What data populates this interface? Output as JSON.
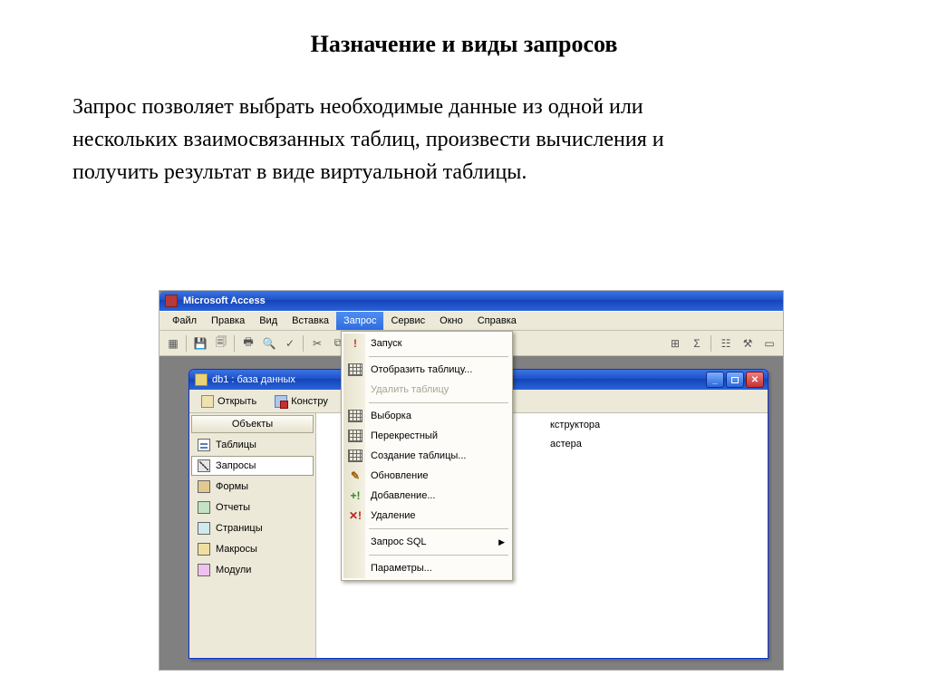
{
  "slide": {
    "title": "Назначение и виды запросов",
    "paragraph": "Запрос позволяет выбрать необходимые данные из одной или нескольких взаимосвязанных таблиц, произвести вычисления и получить результат в виде виртуальной таблицы."
  },
  "app": {
    "title": "Microsoft Access"
  },
  "menubar": [
    "Файл",
    "Правка",
    "Вид",
    "Вставка",
    "Запрос",
    "Сервис",
    "Окно",
    "Справка"
  ],
  "menubar_active_index": 4,
  "dropdown": {
    "items": [
      {
        "label": "Запуск",
        "icon": "run",
        "disabled": false
      },
      {
        "sep": true
      },
      {
        "label": "Отобразить таблицу...",
        "icon": "grid",
        "disabled": false
      },
      {
        "label": "Удалить таблицу",
        "icon": "",
        "disabled": true
      },
      {
        "sep": true
      },
      {
        "label": "Выборка",
        "icon": "grid",
        "disabled": false
      },
      {
        "label": "Перекрестный",
        "icon": "grid",
        "disabled": false
      },
      {
        "label": "Создание таблицы...",
        "icon": "grid",
        "disabled": false
      },
      {
        "label": "Обновление",
        "icon": "update",
        "disabled": false
      },
      {
        "label": "Добавление...",
        "icon": "add",
        "disabled": false
      },
      {
        "label": "Удаление",
        "icon": "del",
        "disabled": false
      },
      {
        "sep": true
      },
      {
        "label": "Запрос SQL",
        "icon": "",
        "submenu": true
      },
      {
        "sep": true
      },
      {
        "label": "Параметры...",
        "icon": "",
        "disabled": false
      }
    ]
  },
  "childwin": {
    "title": "db1 : база данных",
    "toolbar": {
      "open": "Открыть",
      "design": "Констру"
    }
  },
  "objects": {
    "header": "Объекты",
    "items": [
      {
        "label": "Таблицы",
        "ico": "oi-table"
      },
      {
        "label": "Запросы",
        "ico": "oi-query",
        "selected": true
      },
      {
        "label": "Формы",
        "ico": "oi-form"
      },
      {
        "label": "Отчеты",
        "ico": "oi-report"
      },
      {
        "label": "Страницы",
        "ico": "oi-page"
      },
      {
        "label": "Макросы",
        "ico": "oi-macro"
      },
      {
        "label": "Модули",
        "ico": "oi-module"
      }
    ]
  },
  "list_fragments": [
    "кструктора",
    "астера"
  ]
}
